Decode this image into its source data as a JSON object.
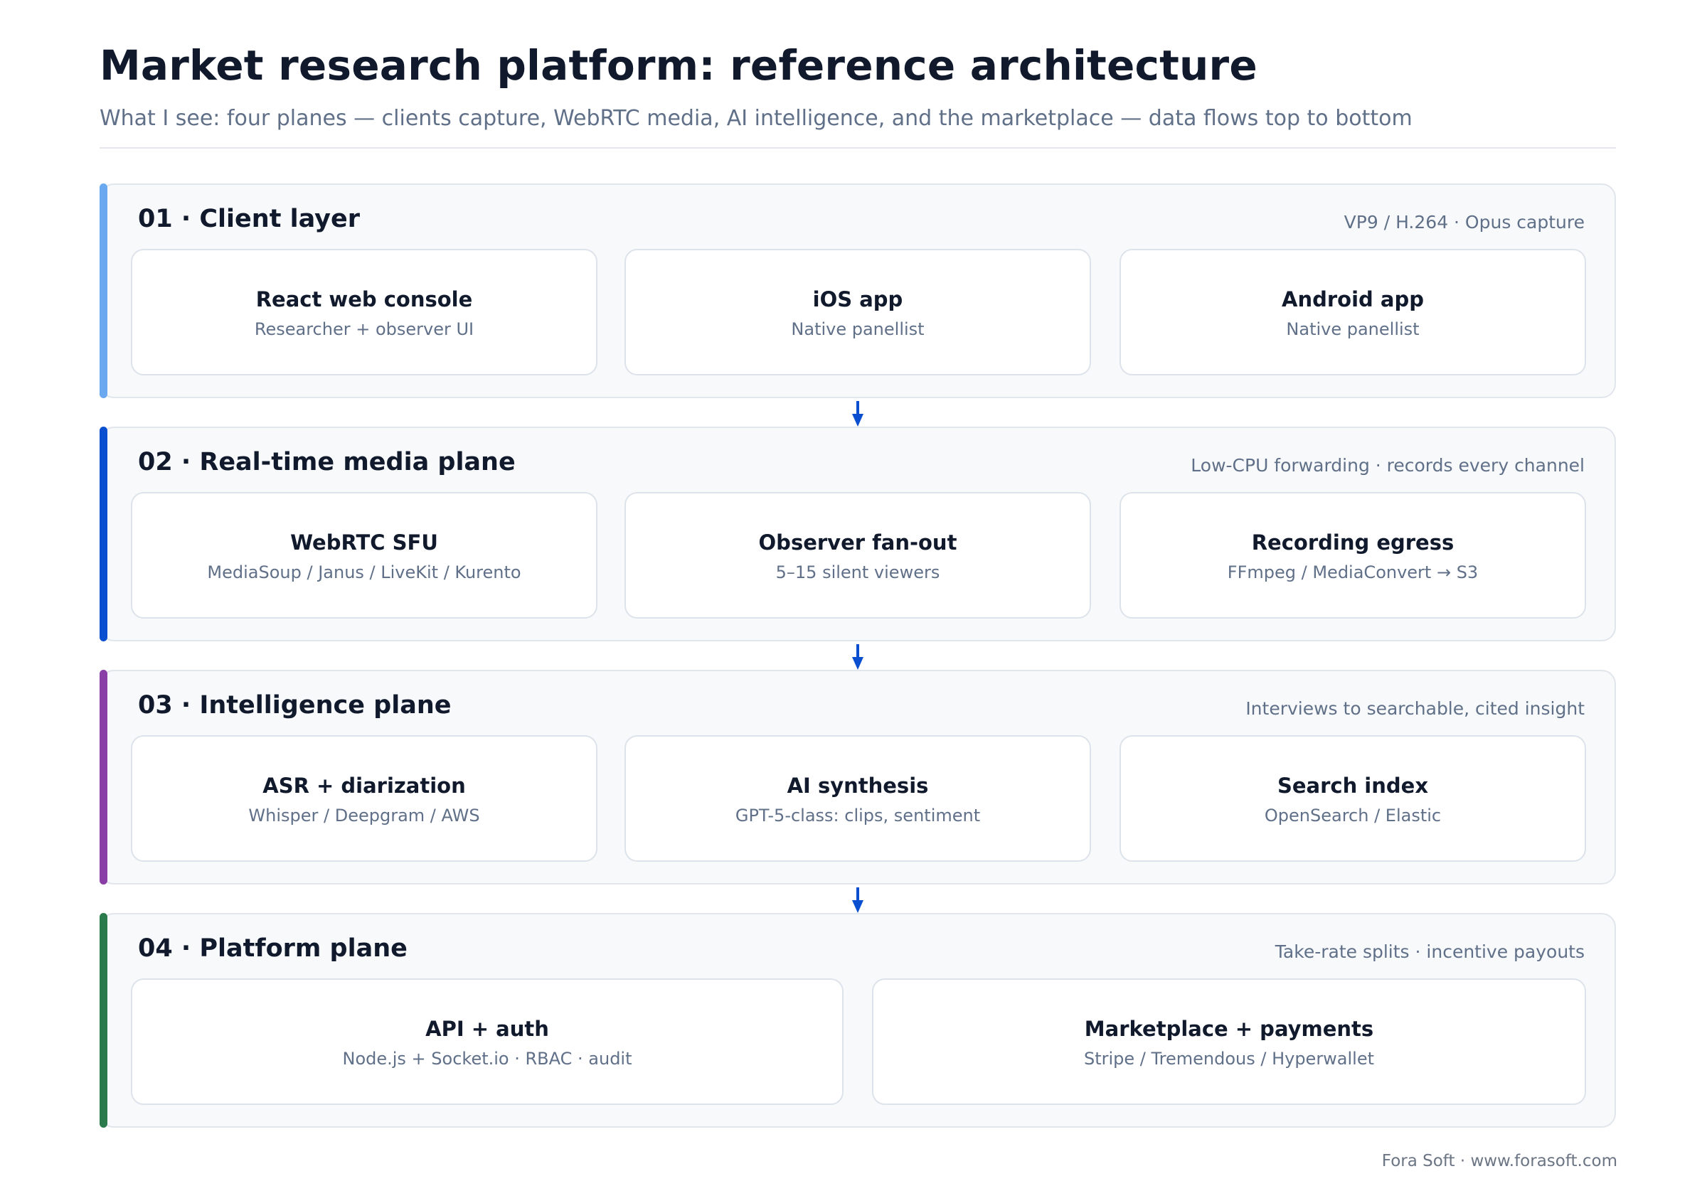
{
  "header": {
    "title": "Market research platform: reference architecture",
    "subtitle": "What I see: four planes — clients capture, WebRTC media, AI intelligence, and the marketplace — data flows top to bottom"
  },
  "colors": {
    "client_accent": "#6aa9f0",
    "media_accent": "#0a4fd0",
    "intelligence_accent": "#8a3fa6",
    "platform_accent": "#2b7a4b",
    "arrow": "#0a4fd0"
  },
  "planes": [
    {
      "title": "01 · Client layer",
      "note": "VP9 / H.264 · Opus capture",
      "cards": [
        {
          "title": "React web console",
          "sub": "Researcher + observer UI"
        },
        {
          "title": "iOS app",
          "sub": "Native panellist"
        },
        {
          "title": "Android app",
          "sub": "Native panellist"
        }
      ]
    },
    {
      "title": "02 · Real-time media plane",
      "note": "Low-CPU forwarding · records every channel",
      "cards": [
        {
          "title": "WebRTC SFU",
          "sub": "MediaSoup / Janus / LiveKit / Kurento"
        },
        {
          "title": "Observer fan-out",
          "sub": "5–15 silent viewers"
        },
        {
          "title": "Recording egress",
          "sub": "FFmpeg / MediaConvert → S3"
        }
      ]
    },
    {
      "title": "03 · Intelligence plane",
      "note": "Interviews to searchable, cited insight",
      "cards": [
        {
          "title": "ASR + diarization",
          "sub": "Whisper / Deepgram / AWS"
        },
        {
          "title": "AI synthesis",
          "sub": "GPT-5-class: clips, sentiment"
        },
        {
          "title": "Search index",
          "sub": "OpenSearch / Elastic"
        }
      ]
    },
    {
      "title": "04 · Platform plane",
      "note": "Take-rate splits · incentive payouts",
      "cards": [
        {
          "title": "API + auth",
          "sub": "Node.js + Socket.io · RBAC · audit"
        },
        {
          "title": "Marketplace + payments",
          "sub": "Stripe / Tremendous / Hyperwallet"
        }
      ]
    }
  ],
  "footer": "Fora Soft · www.forasoft.com"
}
